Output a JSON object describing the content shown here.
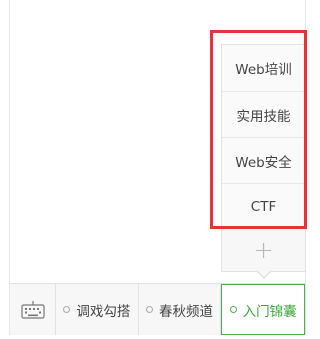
{
  "menu": {
    "items": [
      {
        "label": "调戏勾搭"
      },
      {
        "label": "春秋频道"
      },
      {
        "label": "入门锦囊"
      }
    ]
  },
  "submenu": {
    "items": [
      {
        "label": "Web培训"
      },
      {
        "label": "实用技能"
      },
      {
        "label": "Web安全"
      },
      {
        "label": "CTF"
      }
    ],
    "toggle_symbol": "+"
  },
  "colors": {
    "highlight": "#e83438",
    "active": "#3aa83a",
    "border": "#e2e2e2"
  },
  "icons": {
    "keyboard": "keyboard-icon",
    "expand": "plus-icon",
    "submenu_marker": "dot-icon"
  }
}
